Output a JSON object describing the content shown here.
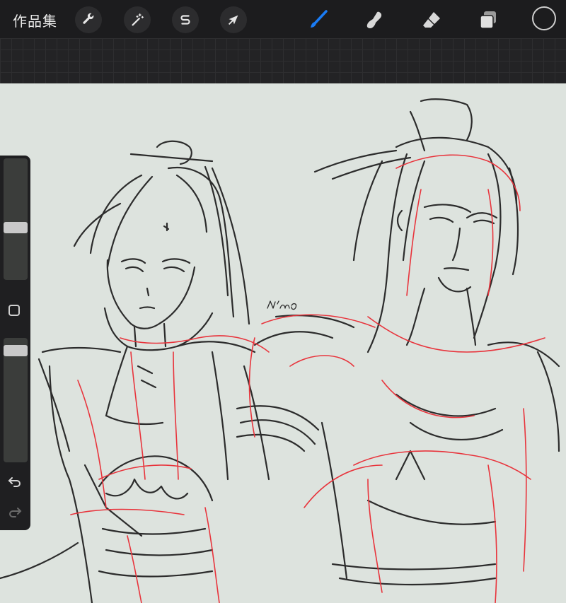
{
  "topbar": {
    "gallery_label": "作品集",
    "left_tools": [
      {
        "name": "actions",
        "icon": "wrench-icon"
      },
      {
        "name": "adjustments",
        "icon": "magic-wand-icon"
      },
      {
        "name": "selection",
        "icon": "selection-s-icon"
      },
      {
        "name": "transform",
        "icon": "arrow-cursor-icon"
      }
    ],
    "right_tools": [
      {
        "name": "brush",
        "icon": "brush-icon",
        "active": true
      },
      {
        "name": "smudge",
        "icon": "smudge-finger-icon"
      },
      {
        "name": "eraser",
        "icon": "eraser-icon"
      },
      {
        "name": "layers",
        "icon": "layers-icon"
      }
    ],
    "current_color": "#1c1c1e"
  },
  "sidebar": {
    "brush_size_level": 0.58,
    "opacity_level": 0.06,
    "icons": [
      "modify-square-icon",
      "undo-icon",
      "redo-icon"
    ]
  },
  "colors": {
    "accent": "#1a7cf5",
    "sketch_line": "#2a2a2a",
    "sketch_red": "#e8343c",
    "canvas_bg": "#dde3de"
  },
  "canvas": {
    "signature": "Nin..."
  }
}
